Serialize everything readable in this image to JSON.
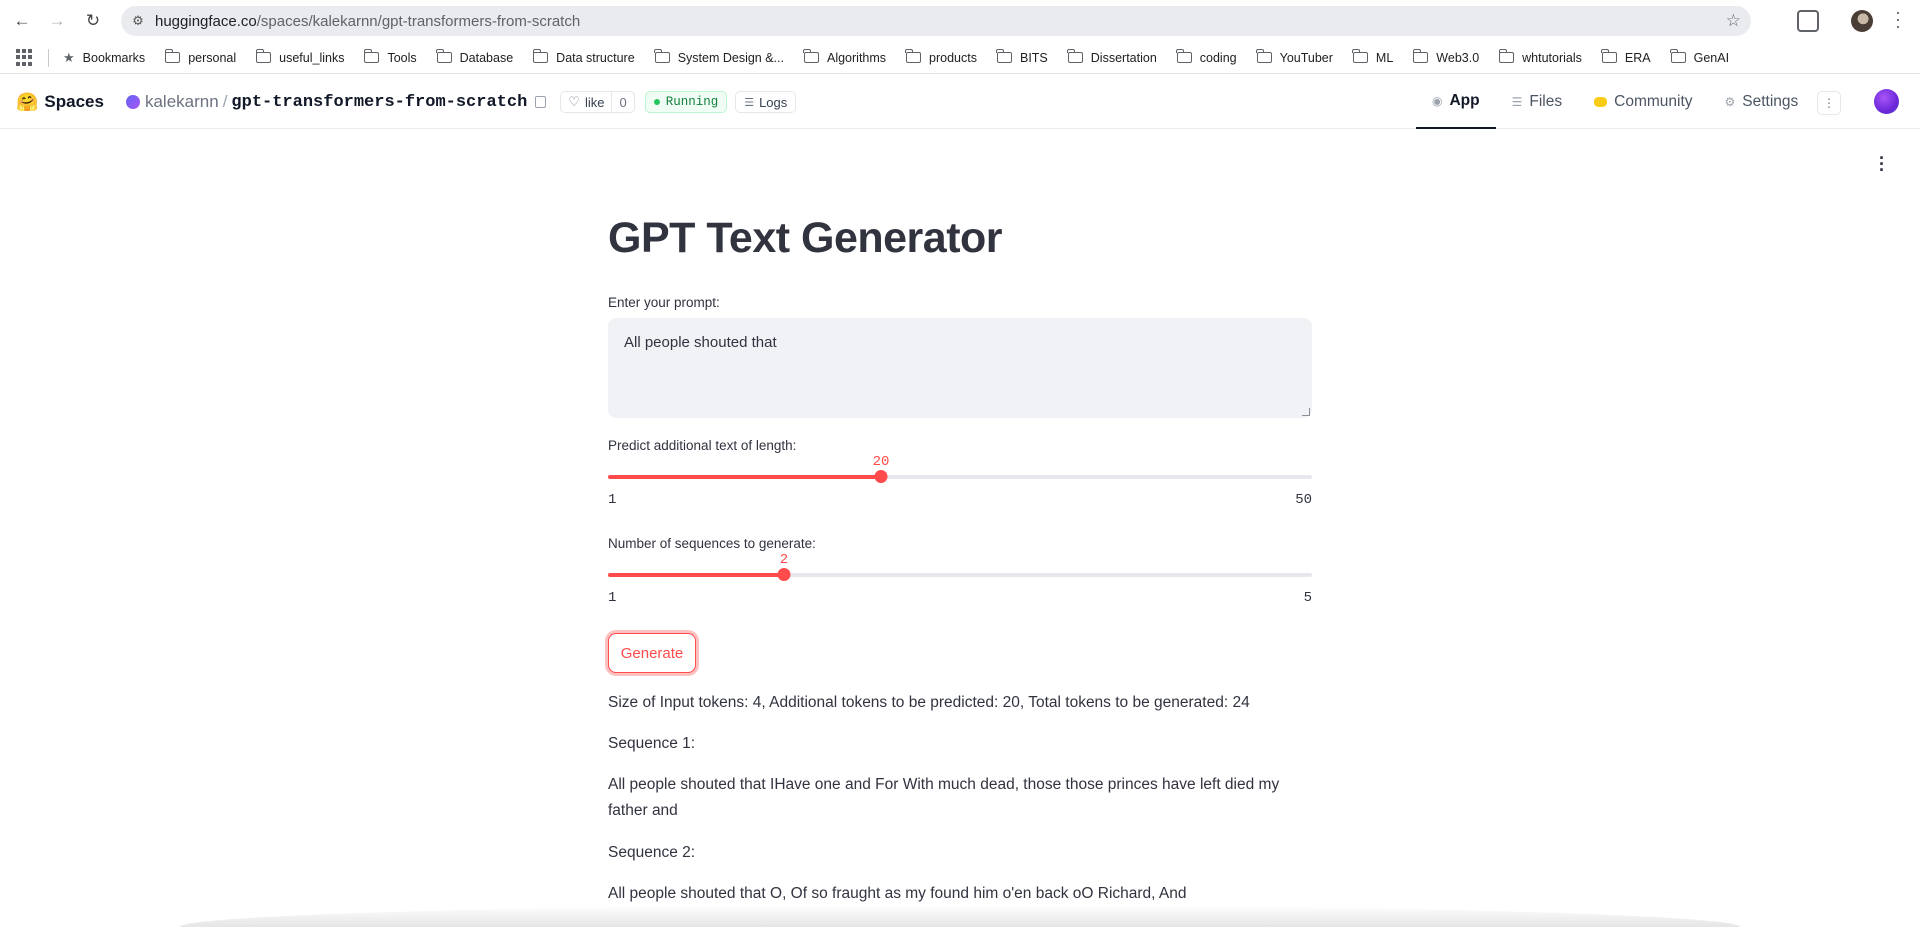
{
  "browser": {
    "url_host": "huggingface.co",
    "url_path": "/spaces/kalekarnn/gpt-transformers-from-scratch",
    "back_icon": "arrow-left-icon",
    "forward_icon": "arrow-right-icon",
    "reload_icon": "reload-icon",
    "bookmark_star_icon": "star-icon"
  },
  "bookmarks": {
    "starred_label": "Bookmarks",
    "folders": [
      "personal",
      "useful_links",
      "Tools",
      "Database",
      "Data structure",
      "System Design &...",
      "Algorithms",
      "products",
      "BITS",
      "Dissertation",
      "coding",
      "YouTuber",
      "ML",
      "Web3.0",
      "whtutorials",
      "ERA",
      "GenAI"
    ]
  },
  "space_header": {
    "emoji": "🤗",
    "spaces_label": "Spaces",
    "owner": "kalekarnn",
    "separator": "/",
    "repo": "gpt-transformers-from-scratch",
    "like_label": "like",
    "like_count": "0",
    "status": "Running",
    "logs_label": "Logs",
    "tabs": [
      {
        "label": "App",
        "active": true
      },
      {
        "label": "Files",
        "active": false
      },
      {
        "label": "Community",
        "active": false
      },
      {
        "label": "Settings",
        "active": false
      }
    ],
    "status_color": "#15803d"
  },
  "app": {
    "title": "GPT Text Generator",
    "prompt_label": "Enter your prompt:",
    "prompt_value": "All people shouted that",
    "length_slider": {
      "label": "Predict additional text of length:",
      "value": "20",
      "min": "1",
      "max": "50"
    },
    "sequences_slider": {
      "label": "Number of sequences to generate:",
      "value": "2",
      "min": "1",
      "max": "5"
    },
    "generate_label": "Generate",
    "token_info": "Size of Input tokens: 4, Additional tokens to be predicted: 20, Total tokens to be generated: 24",
    "sequences": [
      {
        "heading": "Sequence 1:",
        "text": "All people shouted that IHave one and For With much dead, those those princes have left died my father and"
      },
      {
        "heading": "Sequence 2:",
        "text": "All people shouted that O, Of so fraught as my found him o'en back oO Richard, And"
      }
    ],
    "accent_color": "#ff4b4b"
  }
}
